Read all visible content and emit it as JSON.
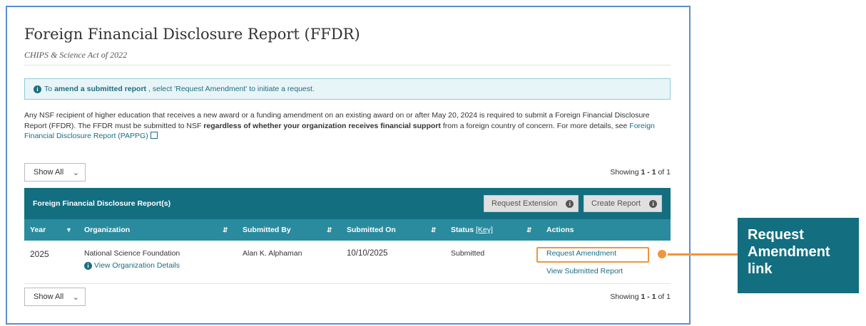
{
  "page": {
    "title": "Foreign Financial Disclosure Report (FFDR)",
    "subtitle": "CHIPS & Science Act of 2022"
  },
  "alert": {
    "prefix": "To",
    "bold": "amend a submitted report",
    "suffix": ", select 'Request Amendment' to initiate a request."
  },
  "intro": {
    "text1": "Any NSF recipient of higher education that receives a new award or a funding amendment on an existing award on or after May 20, 2024 is required to submit a Foreign Financial Disclosure Report (FFDR). The FFDR must be submitted to NSF",
    "bold": "regardless of whether your organization receives financial support",
    "text2": "from a foreign country of concern. For more details, see",
    "link": "Foreign Financial Disclosure Report (PAPPG)"
  },
  "filter": {
    "selected": "Show All"
  },
  "showing": {
    "prefix": "Showing",
    "range": "1 - 1",
    "of_label": "of",
    "total": "1"
  },
  "table": {
    "title": "Foreign Financial Disclosure Report(s)",
    "buttons": {
      "request_extension": "Request Extension",
      "create_report": "Create Report"
    },
    "columns": {
      "year": "Year",
      "organization": "Organization",
      "submitted_by": "Submitted By",
      "submitted_on": "Submitted On",
      "status": "Status",
      "status_key": "[Key]",
      "actions": "Actions"
    },
    "rows": [
      {
        "year": "2025",
        "organization": "National Science Foundation",
        "org_link": "View Organization Details",
        "submitted_by": "Alan K. Alphaman",
        "submitted_on": "10/10/2025",
        "status": "Submitted",
        "action_amend": "Request Amendment",
        "action_view": "View Submitted Report"
      }
    ]
  },
  "callout": {
    "line1": "Request",
    "line2": "Amendment",
    "line3": "link"
  },
  "colors": {
    "header": "#136e80",
    "subheader": "#2a8b9e",
    "accent": "#f0953d",
    "link": "#1a6c86"
  }
}
